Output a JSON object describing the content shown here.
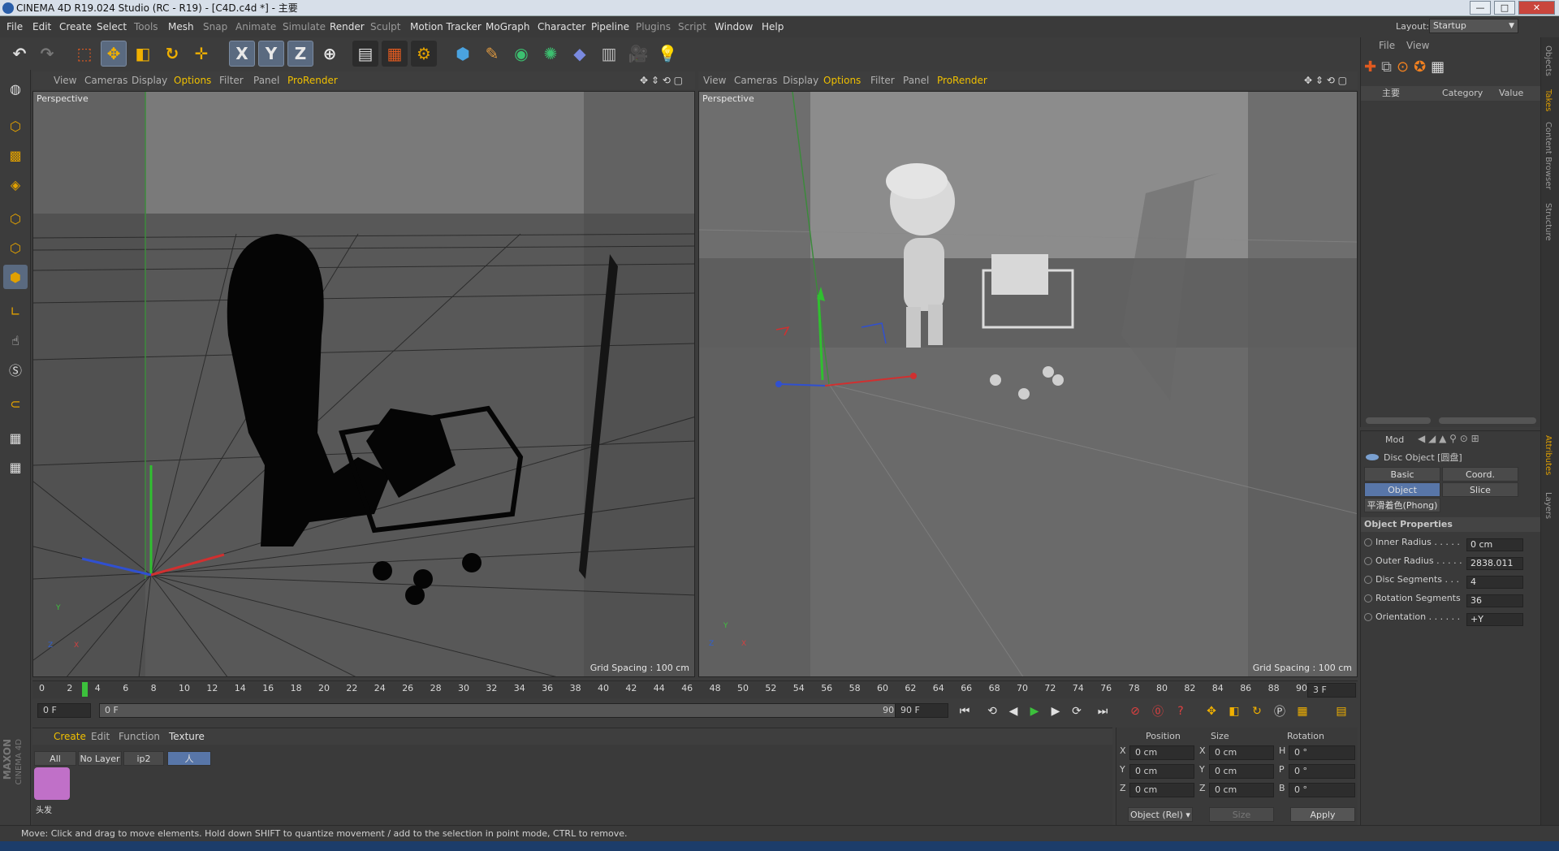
{
  "window": {
    "title": "CINEMA 4D R19.024 Studio (RC - R19) - [C4D.c4d *] - 主要",
    "minimize": "—",
    "maximize": "□",
    "close": "✕"
  },
  "menubar": {
    "items": [
      "File",
      "Edit",
      "Create",
      "Select",
      "Tools",
      "Mesh",
      "Snap",
      "Animate",
      "Simulate",
      "Render",
      "Sculpt",
      "Motion Tracker",
      "MoGraph",
      "Character",
      "Pipeline",
      "Plugins",
      "Script",
      "Window",
      "Help"
    ],
    "layout_label": "Layout:",
    "layout_value": "Startup"
  },
  "toolbar": {
    "axis_x": "X",
    "axis_y": "Y",
    "axis_z": "Z"
  },
  "viewport_menu": [
    "View",
    "Cameras",
    "Display",
    "Options",
    "Filter",
    "Panel",
    "ProRender"
  ],
  "viewport_left": {
    "label": "Perspective",
    "grid": "Grid Spacing : 100 cm"
  },
  "viewport_right": {
    "label": "Perspective",
    "grid": "Grid Spacing : 100 cm"
  },
  "timeline": {
    "ticks": [
      "0",
      "2",
      "4",
      "6",
      "8",
      "10",
      "12",
      "14",
      "16",
      "18",
      "20",
      "22",
      "24",
      "26",
      "28",
      "30",
      "32",
      "34",
      "36",
      "38",
      "40",
      "42",
      "44",
      "46",
      "48",
      "50",
      "52",
      "54",
      "56",
      "58",
      "60",
      "62",
      "64",
      "66",
      "68",
      "70",
      "72",
      "74",
      "76",
      "78",
      "80",
      "82",
      "84",
      "86",
      "88",
      "90"
    ],
    "current_frame": "3",
    "frame_field": "3 F"
  },
  "transport": {
    "start": "0 F",
    "range_start": "0 F",
    "range_end": "90 F",
    "end": "90 F"
  },
  "material_manager": {
    "menu": [
      "Create",
      "Edit",
      "Function",
      "Texture"
    ],
    "tabs": [
      "All",
      "No Layer",
      "ip2",
      "人"
    ],
    "material_name": "头发",
    "maxon": "MAXON",
    "c4d": "CINEMA 4D"
  },
  "coord_manager": {
    "headers": [
      "Position",
      "Size",
      "Rotation"
    ],
    "rows": [
      {
        "axis": "X",
        "pos": "0 cm",
        "size_axis": "X",
        "size": "0 cm",
        "rot_axis": "H",
        "rot": "0 °"
      },
      {
        "axis": "Y",
        "pos": "0 cm",
        "size_axis": "Y",
        "size": "0 cm",
        "rot_axis": "P",
        "rot": "0 °"
      },
      {
        "axis": "Z",
        "pos": "0 cm",
        "size_axis": "Z",
        "size": "0 cm",
        "rot_axis": "B",
        "rot": "0 °"
      }
    ],
    "mode": "Object (Rel)",
    "size_mode": "Size",
    "apply": "Apply"
  },
  "objects_panel": {
    "menu": [
      "File",
      "View"
    ],
    "columns": [
      "主要",
      "Category",
      "Value"
    ]
  },
  "attributes": {
    "menu": "Mod",
    "object_title": "Disc Object [圆盘]",
    "tabs": [
      "Basic",
      "Coord.",
      "Object",
      "Slice"
    ],
    "phong": "平滑着色(Phong)",
    "section": "Object Properties",
    "props": [
      {
        "label": "Inner Radius . . . . .",
        "value": "0 cm"
      },
      {
        "label": "Outer Radius . . . . .",
        "value": "2838.011"
      },
      {
        "label": "Disc Segments . . .",
        "value": "4"
      },
      {
        "label": "Rotation Segments",
        "value": "36"
      },
      {
        "label": "Orientation . . . . . .",
        "value": "+Y"
      }
    ]
  },
  "side_tabs": [
    "Objects",
    "Takes",
    "Content Browser",
    "Structure",
    "Attributes",
    "Layers"
  ],
  "status": "Move: Click and drag to move elements. Hold down SHIFT to quantize movement / add to the selection in point mode, CTRL to remove."
}
